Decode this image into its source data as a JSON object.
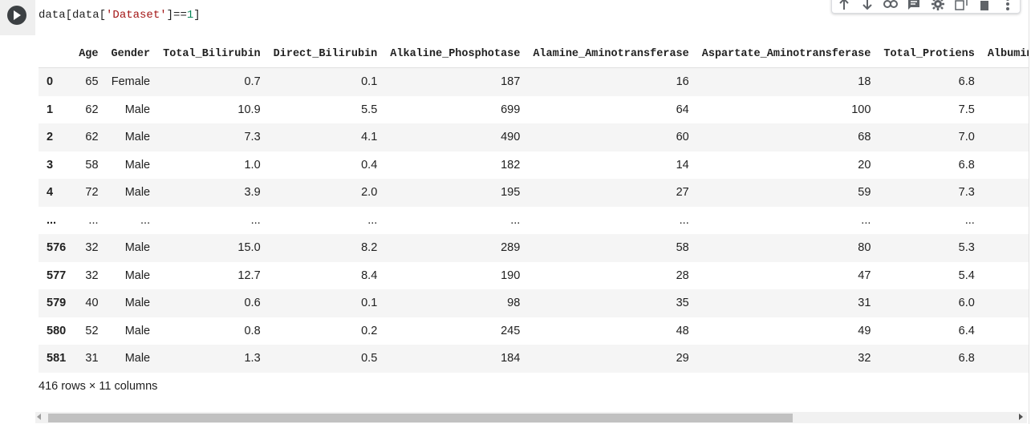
{
  "cell": {
    "code_prefix": "data[data[",
    "code_string": "'Dataset'",
    "code_mid": "]==",
    "code_number": "1",
    "code_suffix": "]"
  },
  "toolbar": {
    "icons": [
      "arrow-up-icon",
      "arrow-down-icon",
      "link-icon",
      "comment-icon",
      "gear-icon",
      "mirror-cell-icon",
      "delete-icon",
      "more-vert-icon"
    ]
  },
  "table": {
    "columns": [
      "",
      "Age",
      "Gender",
      "Total_Bilirubin",
      "Direct_Bilirubin",
      "Alkaline_Phosphotase",
      "Alamine_Aminotransferase",
      "Aspartate_Aminotransferase",
      "Total_Protiens",
      "Albumin"
    ],
    "rows": [
      [
        "0",
        "65",
        "Female",
        "0.7",
        "0.1",
        "187",
        "16",
        "18",
        "6.8",
        ""
      ],
      [
        "1",
        "62",
        "Male",
        "10.9",
        "5.5",
        "699",
        "64",
        "100",
        "7.5",
        ""
      ],
      [
        "2",
        "62",
        "Male",
        "7.3",
        "4.1",
        "490",
        "60",
        "68",
        "7.0",
        ""
      ],
      [
        "3",
        "58",
        "Male",
        "1.0",
        "0.4",
        "182",
        "14",
        "20",
        "6.8",
        ""
      ],
      [
        "4",
        "72",
        "Male",
        "3.9",
        "2.0",
        "195",
        "27",
        "59",
        "7.3",
        ""
      ],
      [
        "...",
        "...",
        "...",
        "...",
        "...",
        "...",
        "...",
        "...",
        "...",
        ""
      ],
      [
        "576",
        "32",
        "Male",
        "15.0",
        "8.2",
        "289",
        "58",
        "80",
        "5.3",
        ""
      ],
      [
        "577",
        "32",
        "Male",
        "12.7",
        "8.4",
        "190",
        "28",
        "47",
        "5.4",
        ""
      ],
      [
        "579",
        "40",
        "Male",
        "0.6",
        "0.1",
        "98",
        "35",
        "31",
        "6.0",
        ""
      ],
      [
        "580",
        "52",
        "Male",
        "0.8",
        "0.2",
        "245",
        "48",
        "49",
        "6.4",
        ""
      ],
      [
        "581",
        "31",
        "Male",
        "1.3",
        "0.5",
        "184",
        "29",
        "32",
        "6.8",
        ""
      ]
    ]
  },
  "footer": {
    "summary": "416 rows × 11 columns"
  }
}
